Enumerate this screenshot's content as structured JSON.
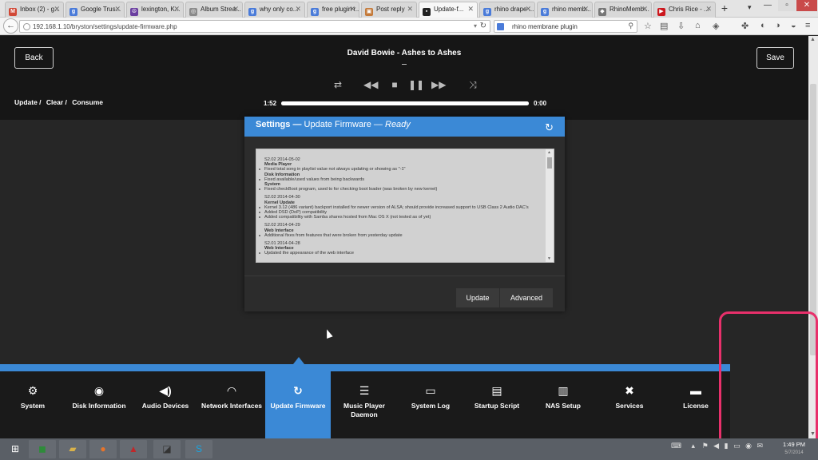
{
  "browser": {
    "tabs": [
      {
        "title": "Inbox (2) - g...",
        "icon": "gmail-icon",
        "color": "#d14836",
        "glyph": "M"
      },
      {
        "title": "Google Trus...",
        "icon": "google-icon",
        "color": "#4a7bd9",
        "glyph": "g"
      },
      {
        "title": "lexington, K...",
        "icon": "peace-icon",
        "color": "#6b3fa0",
        "glyph": "☮"
      },
      {
        "title": "Album Strea...",
        "icon": "globe-icon",
        "color": "#8a8a8a",
        "glyph": "◎"
      },
      {
        "title": "why only co...",
        "icon": "google-icon",
        "color": "#4a7bd9",
        "glyph": "g"
      },
      {
        "title": "free plugin r...",
        "icon": "google-icon",
        "color": "#4a7bd9",
        "glyph": "g"
      },
      {
        "title": "Post reply",
        "icon": "forum-icon",
        "color": "#c47a3a",
        "glyph": "▣"
      },
      {
        "title": "Update-f...",
        "icon": "app-icon",
        "color": "#222222",
        "glyph": "▪"
      },
      {
        "title": "rhino drape ...",
        "icon": "google-icon",
        "color": "#4a7bd9",
        "glyph": "g"
      },
      {
        "title": "rhino memb...",
        "icon": "google-icon",
        "color": "#4a7bd9",
        "glyph": "g"
      },
      {
        "title": "RhinoMemb...",
        "icon": "rhino-icon",
        "color": "#777777",
        "glyph": "◆"
      },
      {
        "title": "Chris Rice - ...",
        "icon": "youtube-icon",
        "color": "#cc181e",
        "glyph": "▶"
      }
    ],
    "url": "192.168.1.10/bryston/settings/update-firmware.php",
    "search_text": "rhino membrane plugin"
  },
  "player": {
    "back_label": "Back",
    "save_label": "Save",
    "song": "David Bowie - Ashes to Ashes",
    "time_elapsed": "1:52",
    "time_total": "0:00",
    "progress": 1.0,
    "crumbs": [
      "Update /",
      "Clear /",
      "Consume"
    ]
  },
  "modal": {
    "title_bold": "Settings —",
    "title_mid": "Update Firmware —",
    "title_status": "Ready",
    "update_label": "Update",
    "advanced_label": "Advanced",
    "changelog": [
      {
        "version": "S2.02 2014-05-02",
        "sections": [
          {
            "name": "Media Player",
            "items": [
              "Fixed total song in playlist value not always updating or showing as \"-1\""
            ]
          },
          {
            "name": "Disk Information",
            "items": [
              "Fixed available/used values from being backwards"
            ]
          },
          {
            "name": "System",
            "items": [
              "Fixed checkBoot program, used to for checking boot loader (was broken by new kernel)"
            ]
          }
        ]
      },
      {
        "version": "S2.02 2014-04-30",
        "sections": [
          {
            "name": "Kernel Update",
            "items": [
              "Kernel 3.12 (486 variant) backport installed for newer version of ALSA; should provide increased support to USB Class 2 Audio DAC's",
              "Added DSD (DoP) compatibility",
              "Added compatibility with Samba shares hosted from Mac OS X (not tested as of yet)"
            ]
          }
        ]
      },
      {
        "version": "S2.02 2014-04-29",
        "sections": [
          {
            "name": "Web Interface",
            "items": [
              "Additional fixes from features that were broken from yesterday update"
            ]
          }
        ]
      },
      {
        "version": "S2.01 2014-04-28",
        "sections": [
          {
            "name": "Web Interface",
            "items": [
              "Updated the appearance of the web interface"
            ]
          }
        ]
      }
    ]
  },
  "menu": [
    {
      "label": "System",
      "icon": "gear-icon",
      "glyph": "⚙",
      "name": "system"
    },
    {
      "label": "Disk Information",
      "icon": "disk-icon",
      "glyph": "◉",
      "name": "disk-information"
    },
    {
      "label": "Audio Devices",
      "icon": "speaker-icon",
      "glyph": "◀)",
      "name": "audio-devices"
    },
    {
      "label": "Network Interfaces",
      "icon": "wifi-icon",
      "glyph": "◠",
      "name": "network-interfaces"
    },
    {
      "label": "Update Firmware",
      "icon": "refresh-icon",
      "glyph": "↻",
      "name": "update-firmware",
      "active": true
    },
    {
      "label": "Music Player Daemon",
      "icon": "list-icon",
      "glyph": "☰",
      "name": "music-player-daemon"
    },
    {
      "label": "System Log",
      "icon": "monitor-icon",
      "glyph": "▭",
      "name": "system-log"
    },
    {
      "label": "Startup Script",
      "icon": "file-icon",
      "glyph": "▤",
      "name": "startup-script"
    },
    {
      "label": "NAS Setup",
      "icon": "server-icon",
      "glyph": "▥",
      "name": "nas-setup"
    },
    {
      "label": "Services",
      "icon": "wrench-icon",
      "glyph": "✖",
      "name": "services"
    },
    {
      "label": "License",
      "icon": "id-card-icon",
      "glyph": "▬",
      "name": "license"
    }
  ],
  "taskbar": {
    "apps": [
      {
        "icon": "start-icon",
        "glyph": "⊞",
        "color": "#5a5f66"
      },
      {
        "icon": "store-icon",
        "glyph": "◼",
        "color": "#2e8b3a"
      },
      {
        "icon": "folder-icon",
        "glyph": "▰",
        "color": "#d9b24a"
      },
      {
        "icon": "firefox-icon",
        "glyph": "●",
        "color": "#e8742a"
      },
      {
        "icon": "acrobat-icon",
        "glyph": "▲",
        "color": "#c0282a"
      },
      {
        "icon": "mixer-icon",
        "glyph": "◪",
        "color": "#333333"
      },
      {
        "icon": "skype-icon",
        "glyph": "S",
        "color": "#1aa4e0"
      }
    ],
    "time": "1:49 PM",
    "date": "5/7/2014"
  },
  "colors": {
    "accent": "#3b89d6",
    "highlight": "#e8306b"
  }
}
